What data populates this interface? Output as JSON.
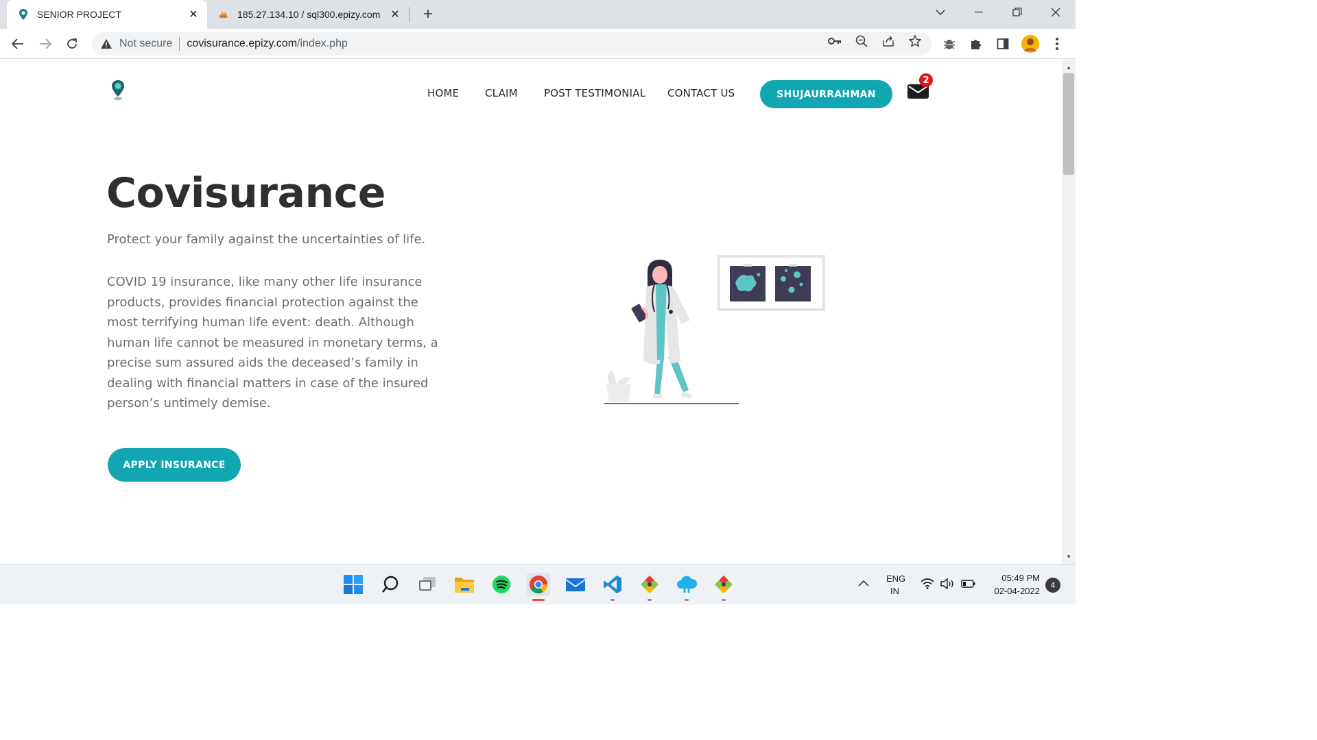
{
  "browser": {
    "tabs": [
      {
        "title": "SENIOR PROJECT",
        "active": true
      },
      {
        "title": "185.27.134.10 / sql300.epizy.com",
        "active": false
      }
    ],
    "address": {
      "security": "Not secure",
      "host": "covisurance.epizy.com",
      "path": "/index.php"
    }
  },
  "site": {
    "nav": {
      "home": "HOME",
      "claim": "CLAIM",
      "testimonial": "POST TESTIMONIAL",
      "contact": "CONTACT US",
      "user": "SHUJAURRAHMAN",
      "mail_count": "2"
    },
    "hero": {
      "title": "Covisurance",
      "tagline": "Protect your family against the uncertainties of life.",
      "description": "COVID 19 insurance, like many other life insurance products, provides financial protection against the most terrifying human life event: death. Although human life cannot be measured in monetary terms, a precise sum assured aids the deceased’s family in dealing with financial matters in case of the insured person’s untimely demise.",
      "cta": "APPLY INSURANCE"
    },
    "colors": {
      "accent": "#12a7b0",
      "heading": "#2f2f2f",
      "text": "#6c6c6c",
      "badge": "#e0171f"
    }
  },
  "taskbar": {
    "apps": [
      "windows-start-icon",
      "search-icon",
      "task-view-icon",
      "file-explorer-icon",
      "spotify-icon",
      "chrome-icon",
      "mail-icon",
      "vscode-icon",
      "git-icon",
      "cloud-app-icon",
      "git-icon"
    ],
    "lang_top": "ENG",
    "lang_bottom": "IN",
    "time": "05:49 PM",
    "date": "02-04-2022",
    "notifications": "4"
  }
}
